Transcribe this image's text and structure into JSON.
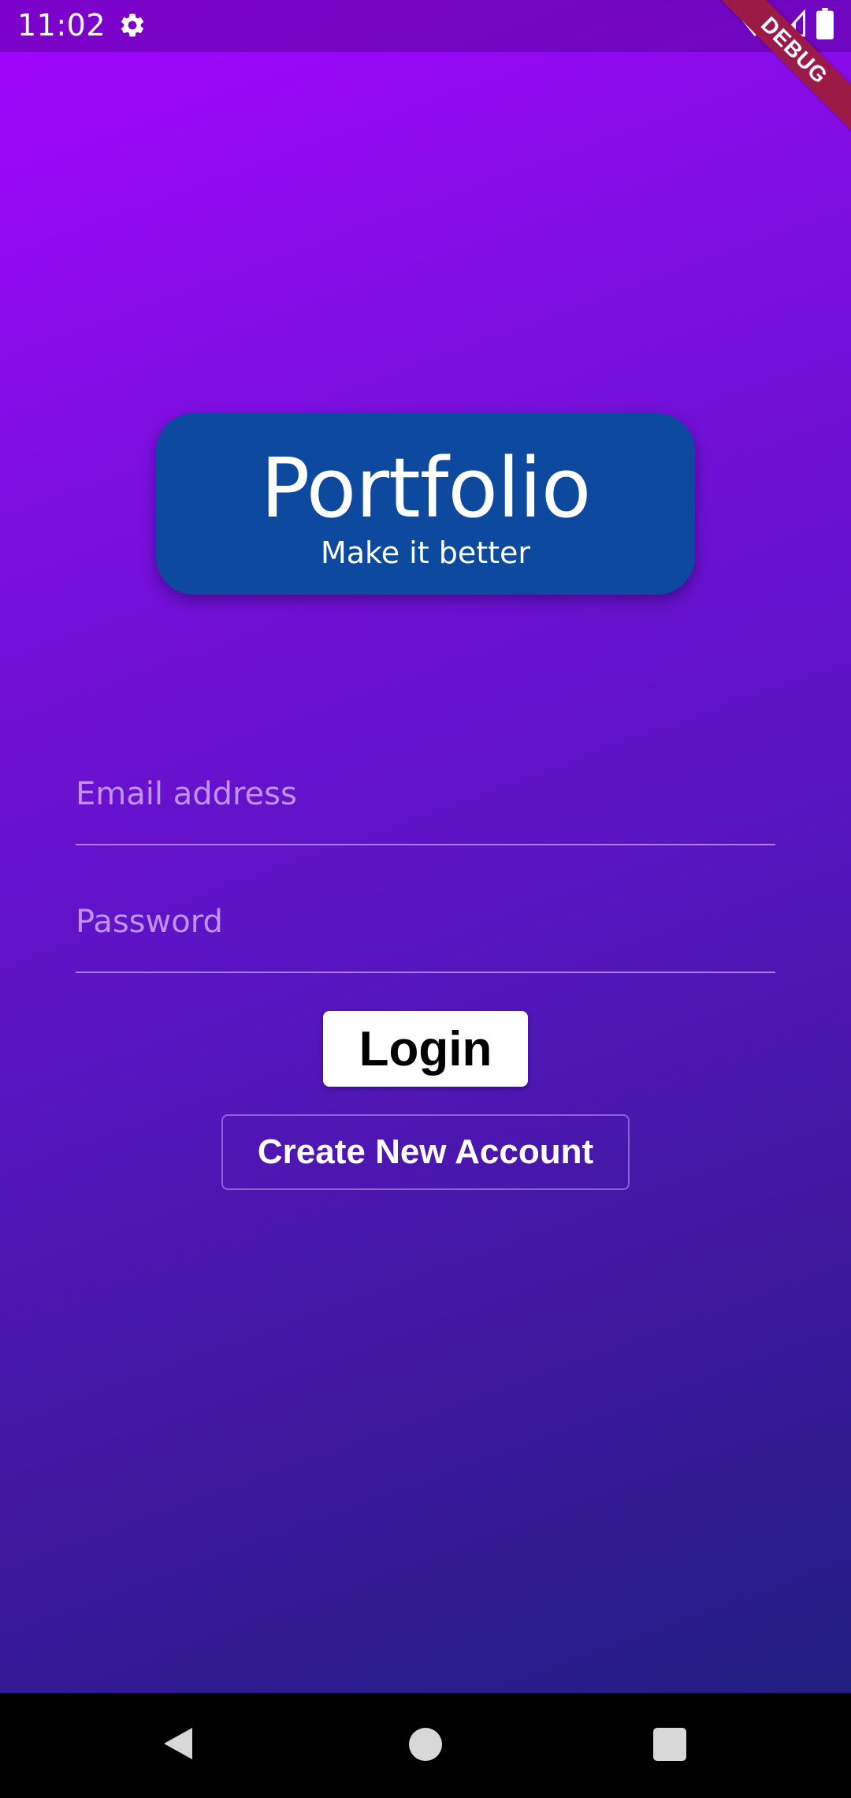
{
  "status_bar": {
    "time": "11:02",
    "icons": [
      "settings-gear-icon",
      "wifi-icon",
      "signal-icon",
      "battery-icon"
    ]
  },
  "debug_banner": {
    "label": "DEBUG",
    "color": "#9b1b46"
  },
  "logo": {
    "title": "Portfolio",
    "subtitle": "Make it better",
    "background_color": "#0d4a9f"
  },
  "login_form": {
    "email": {
      "placeholder": "Email address",
      "value": ""
    },
    "password": {
      "placeholder": "Password",
      "value": ""
    },
    "login_button_label": "Login",
    "create_account_label": "Create New Account"
  },
  "theme": {
    "gradient_start": "#a405fe",
    "gradient_end": "#1a1f7a"
  },
  "nav_bar": {
    "icons": [
      "back-icon",
      "home-icon",
      "recents-icon"
    ]
  }
}
